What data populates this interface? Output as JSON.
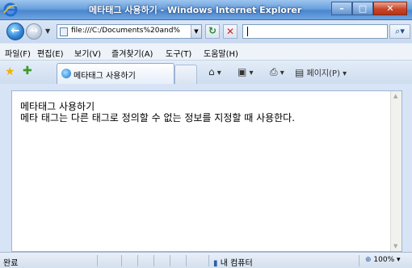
{
  "window": {
    "title": "메타태그 사용하기 - Windows Internet Explorer"
  },
  "address": {
    "url": "file:///C:/Documents%20and%"
  },
  "menu": [
    "파일(F)",
    "편집(E)",
    "보기(V)",
    "즐겨찾기(A)",
    "도구(T)",
    "도움말(H)"
  ],
  "tab": {
    "label": "메타태그 사용하기"
  },
  "commands": {
    "page_label": "페이지(P)"
  },
  "content": {
    "line1": "메타태그 사용하기",
    "line2": "메타 태그는 다른 태그로 정의할 수 없는 정보를 지정할 때 사용한다."
  },
  "status": {
    "text": "완료",
    "zone": "내 컴퓨터",
    "zoom": "100%"
  },
  "icons": [
    "ie-logo-icon",
    "back-arrow-icon",
    "forward-arrow-icon",
    "page-icon",
    "refresh-icon",
    "stop-icon",
    "search-icon",
    "favorites-star-icon",
    "add-favorites-icon",
    "home-icon",
    "feeds-icon",
    "print-icon",
    "page-menu-icon",
    "computer-icon",
    "zoom-icon"
  ]
}
